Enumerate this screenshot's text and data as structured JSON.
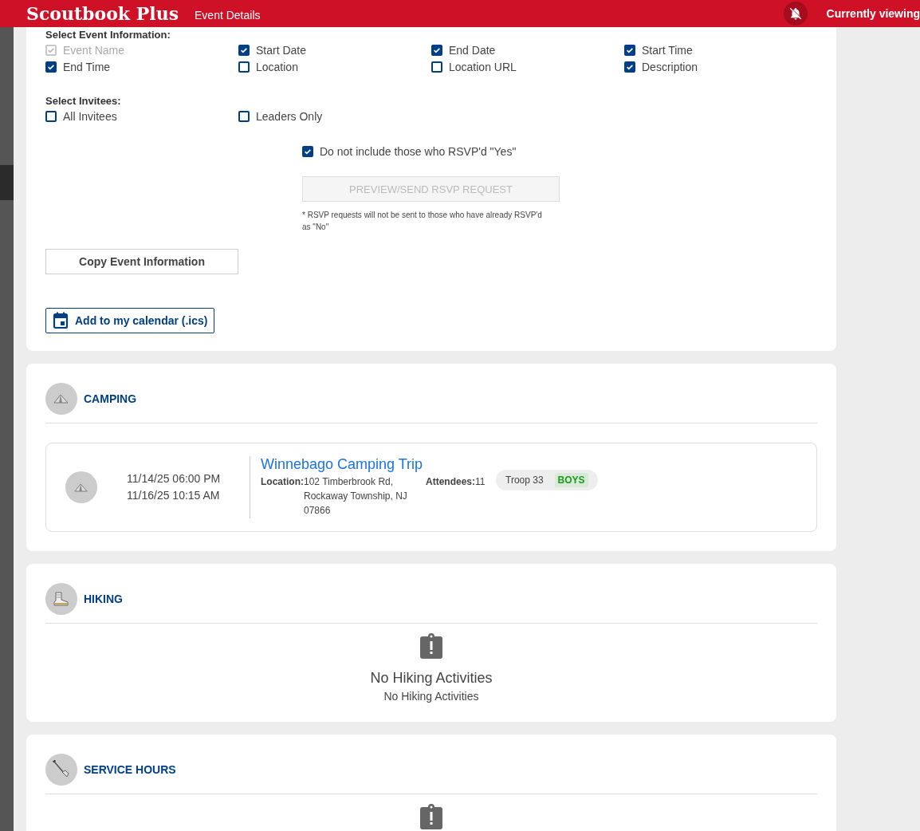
{
  "header": {
    "title": "Scoutbook Plus",
    "subtitle": "Event Details",
    "viewing": "Currently viewing"
  },
  "event_info": {
    "label": "Select Event Information:",
    "options": [
      {
        "label": "Event Name",
        "checked": true,
        "disabled": true
      },
      {
        "label": "Start Date",
        "checked": true,
        "disabled": false
      },
      {
        "label": "End Date",
        "checked": true,
        "disabled": false
      },
      {
        "label": "Start Time",
        "checked": true,
        "disabled": false
      },
      {
        "label": "End Time",
        "checked": true,
        "disabled": false
      },
      {
        "label": "Location",
        "checked": false,
        "disabled": false
      },
      {
        "label": "Location URL",
        "checked": false,
        "disabled": false
      },
      {
        "label": "Description",
        "checked": true,
        "disabled": false
      }
    ]
  },
  "invitees": {
    "label": "Select Invitees:",
    "options": [
      {
        "label": "All Invitees",
        "checked": false,
        "disabled": false
      },
      {
        "label": "Leaders Only",
        "checked": false,
        "disabled": false
      }
    ]
  },
  "exclude_yes": {
    "label": "Do not include those who RSVP'd \"Yes\"",
    "checked": true
  },
  "rsvp_button": {
    "label": "PREVIEW/SEND RSVP REQUEST",
    "disabled": true
  },
  "rsvp_note": "* RSVP requests will not be sent to those who have already RSVP'd as \"No\"",
  "copy_button": "Copy Event Information",
  "calendar_button": "Add to my calendar (.ics)",
  "sections": [
    {
      "title": "CAMPING",
      "kind": "list",
      "events": [
        {
          "start": "11/14/25 06:00 PM",
          "end": "11/16/25 10:15 AM",
          "title": "Winnebago Camping Trip",
          "location_label": "Location:",
          "location": "102 Timberbrook Rd, Rockaway Township, NJ 07866",
          "attendees_label": "Attendees:",
          "attendees": "11",
          "unit": "Troop 33",
          "tag": "BOYS"
        }
      ]
    },
    {
      "title": "HIKING",
      "kind": "empty",
      "empty_title": "No Hiking Activities",
      "empty_text": "No Hiking Activities"
    },
    {
      "title": "SERVICE HOURS",
      "kind": "empty"
    }
  ]
}
